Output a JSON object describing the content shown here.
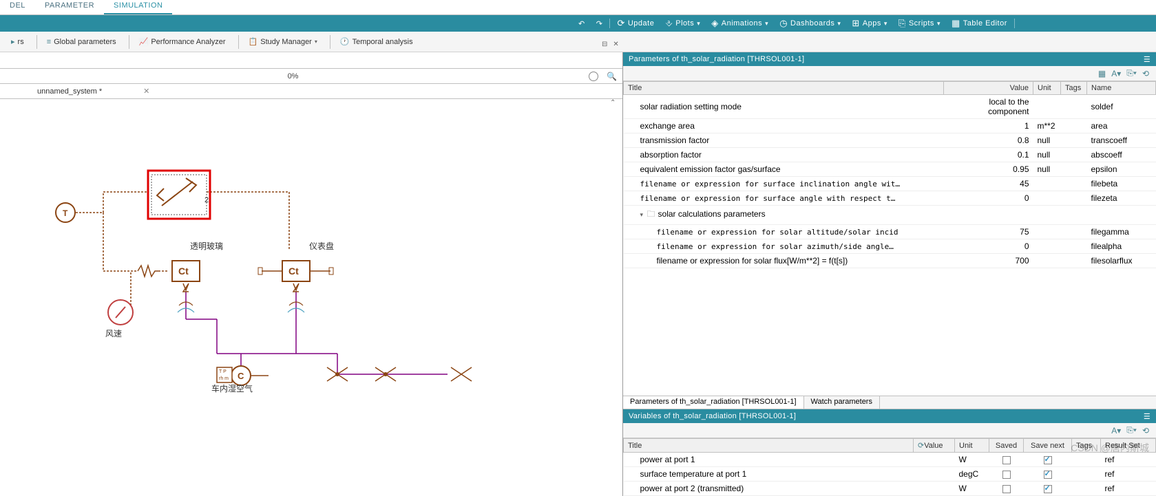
{
  "tabs": {
    "model": "DEL",
    "parameter": "PARAMETER",
    "simulation": "SIMULATION"
  },
  "menu": {
    "update": "Update",
    "plots": "Plots",
    "animations": "Animations",
    "dashboards": "Dashboards",
    "apps": "Apps",
    "scripts": "Scripts",
    "table_editor": "Table Editor"
  },
  "toolbar": {
    "global_params": "Global parameters",
    "perf_analyzer": "Performance Analyzer",
    "study_manager": "Study Manager",
    "temporal_analysis": "Temporal analysis"
  },
  "progress": {
    "pct": "0%"
  },
  "file_tab": "unnamed_system *",
  "canvas_labels": {
    "glass": "透明玻璃",
    "dash": "仪表盘",
    "wind": "风速",
    "air": "车内湿空气",
    "T": "T",
    "Ct": "Ct",
    "C": "C",
    "two": "2"
  },
  "params_panel": {
    "title": "Parameters of th_solar_radiation [THRSOL001-1]",
    "headers": {
      "title": "Title",
      "value": "Value",
      "unit": "Unit",
      "tags": "Tags",
      "name": "Name"
    },
    "rows": [
      {
        "t": "solar radiation setting mode",
        "v": "local to the component",
        "u": "",
        "n": "soldef",
        "i": 1
      },
      {
        "t": "exchange area",
        "v": "1",
        "u": "m**2",
        "n": "area",
        "i": 1
      },
      {
        "t": "transmission factor",
        "v": "0.8",
        "u": "null",
        "n": "transcoeff",
        "i": 1
      },
      {
        "t": "absorption factor",
        "v": "0.1",
        "u": "null",
        "n": "abscoeff",
        "i": 1
      },
      {
        "t": "equivalent emission factor gas/surface",
        "v": "0.95",
        "u": "null",
        "n": "epsilon",
        "i": 1
      },
      {
        "t": "filename or expression for surface inclination angle wit…",
        "v": "45",
        "u": "",
        "n": "filebeta",
        "i": 1,
        "mono": true
      },
      {
        "t": "filename or expression for surface angle with respect t…",
        "v": "0",
        "u": "",
        "n": "filezeta",
        "i": 1,
        "mono": true
      },
      {
        "t": "solar calculations parameters",
        "group": true,
        "i": 1
      },
      {
        "t": "filename or expression for solar altitude/solar incid",
        "v": "75",
        "u": "",
        "n": "filegamma",
        "i": 2,
        "mono": true
      },
      {
        "t": "filename or expression for solar azimuth/side angle…",
        "v": "0",
        "u": "",
        "n": "filealpha",
        "i": 2,
        "mono": true
      },
      {
        "t": "filename or expression for solar flux[W/m**2] = f(t[s])",
        "v": "700",
        "u": "",
        "n": "filesolarflux",
        "i": 2
      }
    ]
  },
  "subtabs": {
    "params": "Parameters of th_solar_radiation [THRSOL001-1]",
    "watch": "Watch parameters"
  },
  "vars_panel": {
    "title": "Variables of th_solar_radiation [THRSOL001-1]",
    "headers": {
      "title": "Title",
      "value": "Value",
      "unit": "Unit",
      "saved": "Saved",
      "savenext": "Save next",
      "tags": "Tags",
      "result": "Result Set"
    },
    "rows": [
      {
        "t": "power at port 1",
        "u": "W",
        "saved": false,
        "sn": true,
        "r": "ref"
      },
      {
        "t": "surface temperature at port 1",
        "u": "degC",
        "saved": false,
        "sn": true,
        "r": "ref"
      },
      {
        "t": "power at port 2 (transmitted)",
        "u": "W",
        "saved": false,
        "sn": true,
        "r": "ref"
      }
    ]
  },
  "watermark": "CSDN @唐内斯城"
}
